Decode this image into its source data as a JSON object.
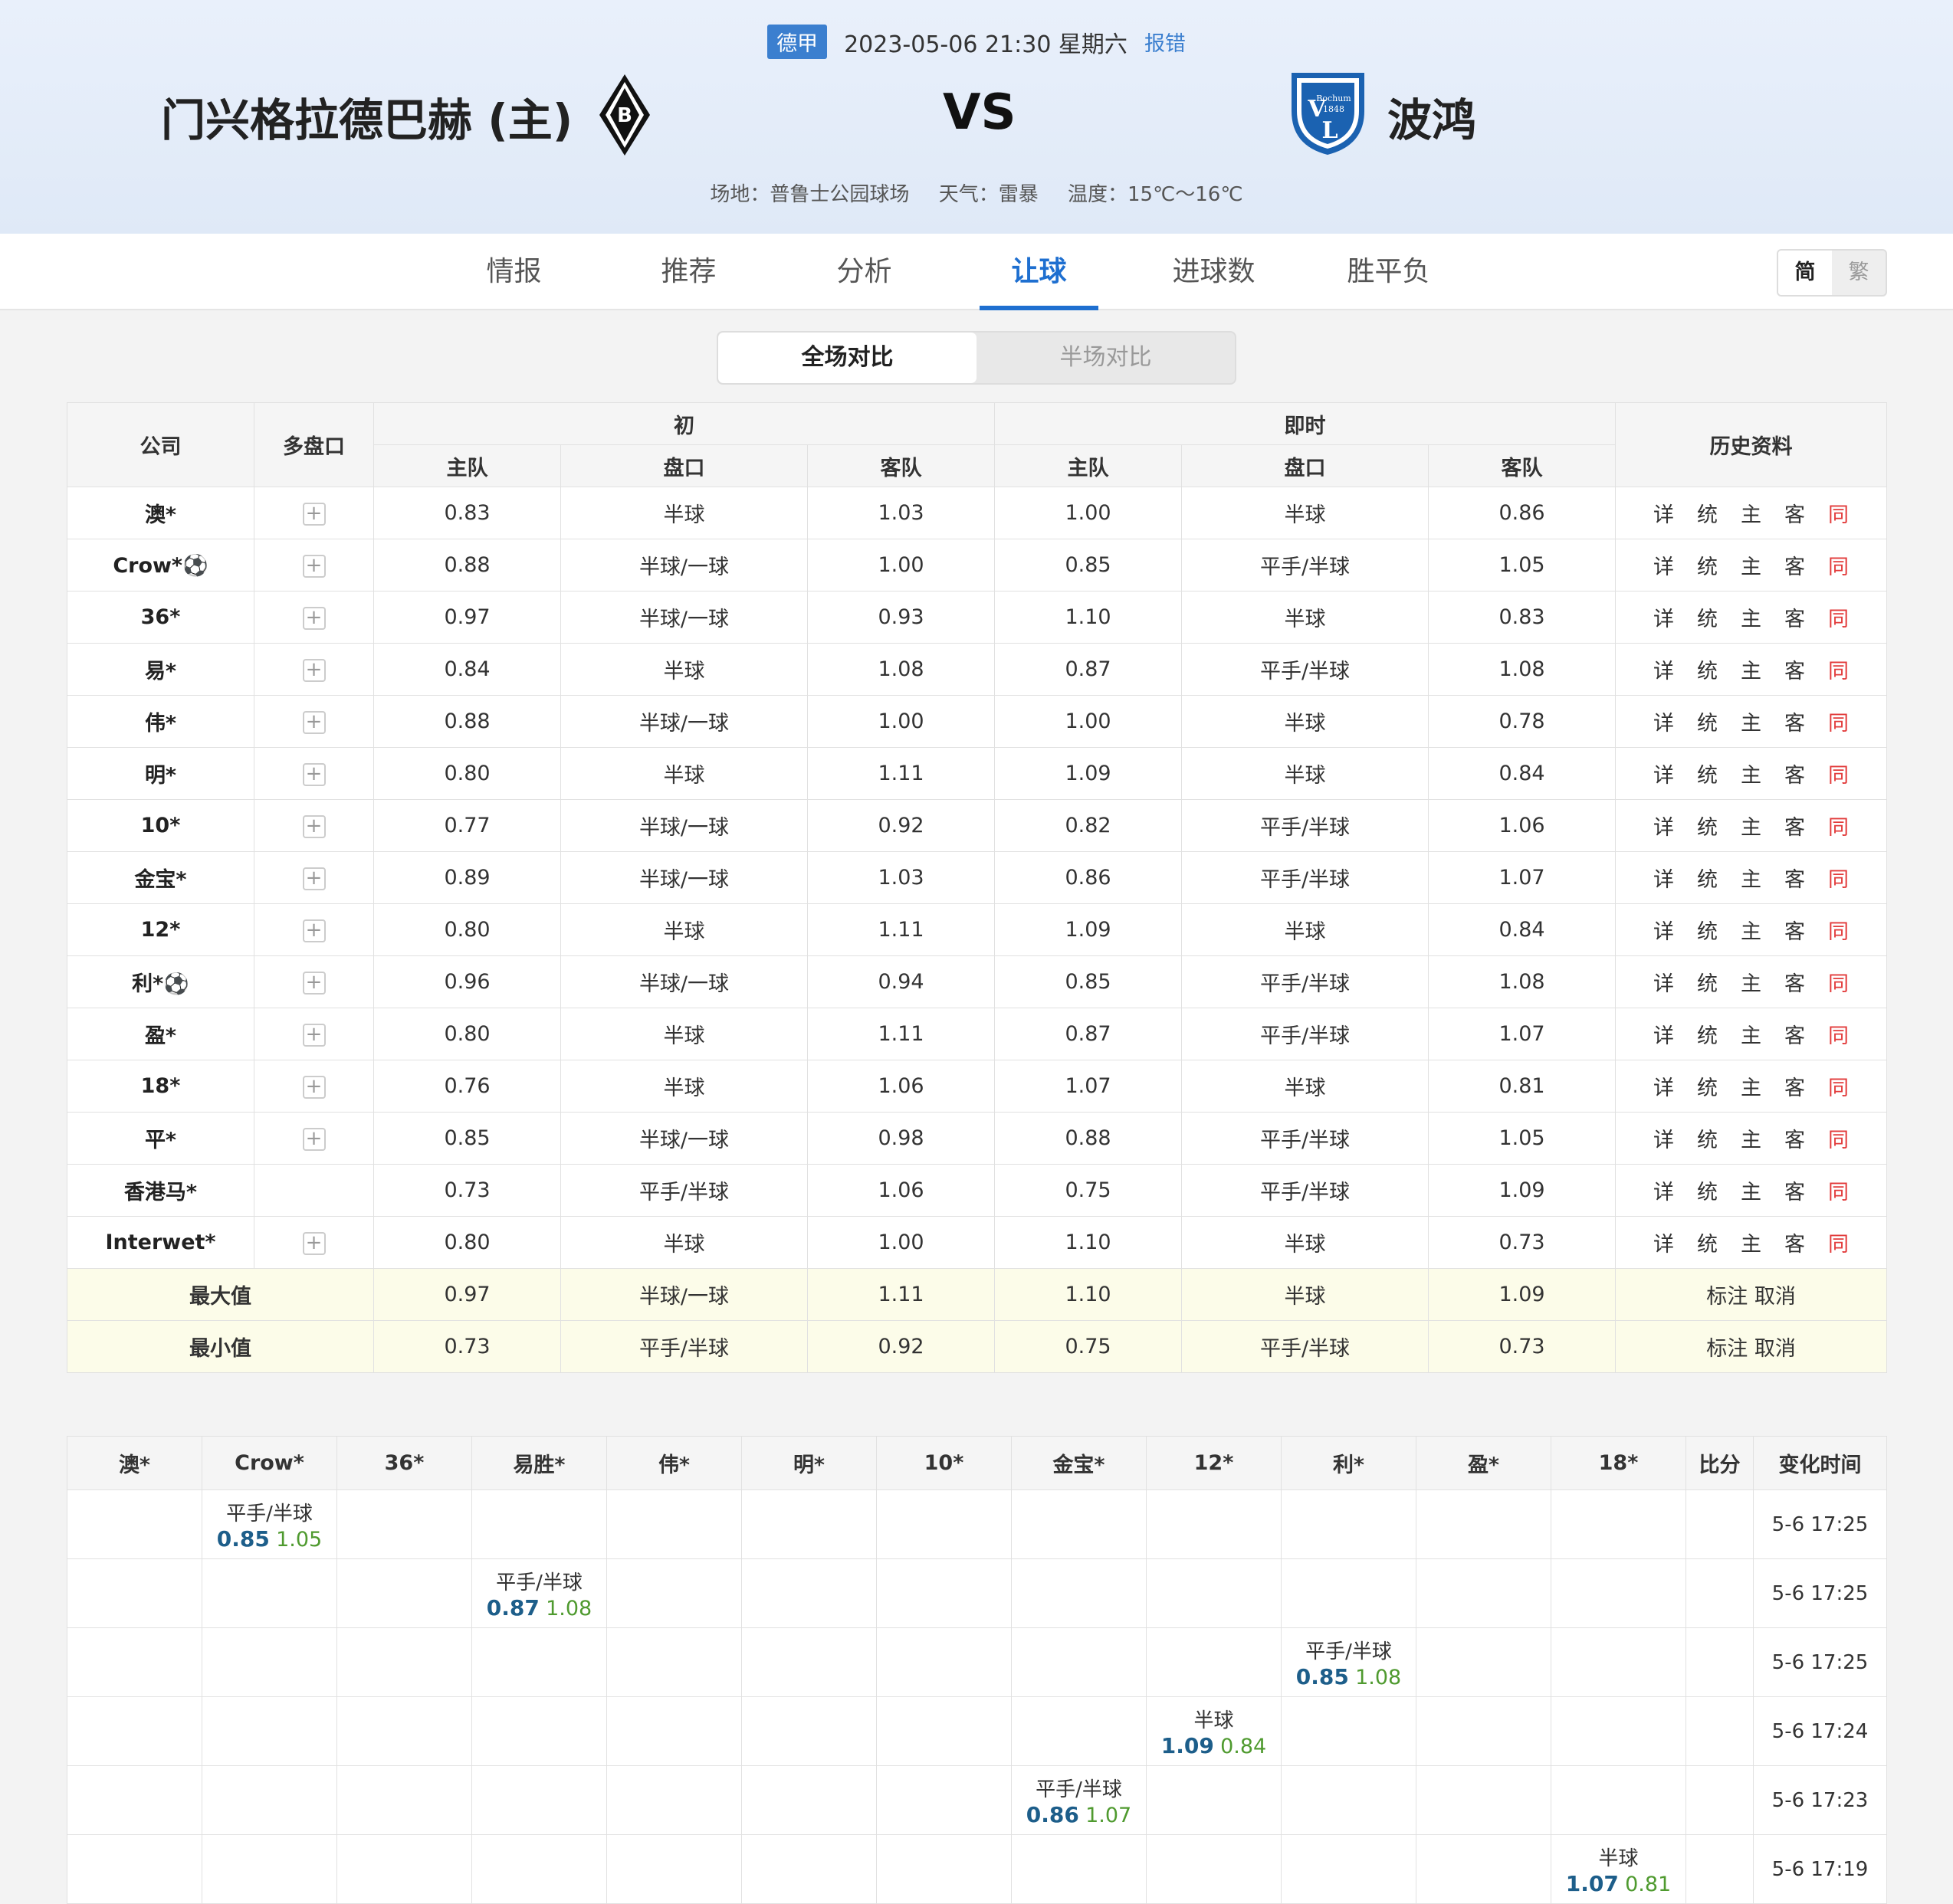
{
  "header": {
    "league": "德甲",
    "datetime": "2023-05-06 21:30 星期六",
    "report": "报错",
    "home": "门兴格拉德巴赫 (主)",
    "vs": "VS",
    "away": "波鸿",
    "venue": "场地：普鲁士公园球场",
    "weather": "天气：雷暴",
    "temperature": "温度：15℃～16℃",
    "away_logo_text": "Bochum 1848"
  },
  "tabs": [
    "情报",
    "推荐",
    "分析",
    "让球",
    "进球数",
    "胜平负"
  ],
  "active_tab": "让球",
  "lang": {
    "simplified": "简",
    "traditional": "繁"
  },
  "segment": {
    "full": "全场对比",
    "half": "半场对比"
  },
  "odds_table": {
    "headers": {
      "company": "公司",
      "multi": "多盘口",
      "initial": "初",
      "live": "即时",
      "history": "历史资料",
      "home": "主队",
      "line": "盘口",
      "away": "客队"
    },
    "history_links": [
      "详",
      "统",
      "主",
      "客",
      "同"
    ],
    "rows": [
      {
        "company": "澳*",
        "plus": true,
        "i_h": "0.83",
        "i_l": "半球",
        "i_a": "1.03",
        "l_h": "1.00",
        "l_l": "半球",
        "l_a": "0.86"
      },
      {
        "company": "Crow*⚽",
        "plus": true,
        "i_h": "0.88",
        "i_l": "半球/一球",
        "i_a": "1.00",
        "l_h": "0.85",
        "l_l": "平手/半球",
        "l_a": "1.05"
      },
      {
        "company": "36*",
        "plus": true,
        "i_h": "0.97",
        "i_l": "半球/一球",
        "i_a": "0.93",
        "l_h": "1.10",
        "l_l": "半球",
        "l_a": "0.83"
      },
      {
        "company": "易*",
        "plus": true,
        "i_h": "0.84",
        "i_l": "半球",
        "i_a": "1.08",
        "l_h": "0.87",
        "l_l": "平手/半球",
        "l_a": "1.08"
      },
      {
        "company": "伟*",
        "plus": true,
        "i_h": "0.88",
        "i_l": "半球/一球",
        "i_a": "1.00",
        "l_h": "1.00",
        "l_l": "半球",
        "l_a": "0.78"
      },
      {
        "company": "明*",
        "plus": true,
        "i_h": "0.80",
        "i_l": "半球",
        "i_a": "1.11",
        "l_h": "1.09",
        "l_l": "半球",
        "l_a": "0.84"
      },
      {
        "company": "10*",
        "plus": true,
        "i_h": "0.77",
        "i_l": "半球/一球",
        "i_a": "0.92",
        "l_h": "0.82",
        "l_l": "平手/半球",
        "l_a": "1.06"
      },
      {
        "company": "金宝*",
        "plus": true,
        "i_h": "0.89",
        "i_l": "半球/一球",
        "i_a": "1.03",
        "l_h": "0.86",
        "l_l": "平手/半球",
        "l_a": "1.07"
      },
      {
        "company": "12*",
        "plus": true,
        "i_h": "0.80",
        "i_l": "半球",
        "i_a": "1.11",
        "l_h": "1.09",
        "l_l": "半球",
        "l_a": "0.84"
      },
      {
        "company": "利*⚽",
        "plus": true,
        "i_h": "0.96",
        "i_l": "半球/一球",
        "i_a": "0.94",
        "l_h": "0.85",
        "l_l": "平手/半球",
        "l_a": "1.08"
      },
      {
        "company": "盈*",
        "plus": true,
        "i_h": "0.80",
        "i_l": "半球",
        "i_a": "1.11",
        "l_h": "0.87",
        "l_l": "平手/半球",
        "l_a": "1.07"
      },
      {
        "company": "18*",
        "plus": true,
        "i_h": "0.76",
        "i_l": "半球",
        "i_a": "1.06",
        "l_h": "1.07",
        "l_l": "半球",
        "l_a": "0.81"
      },
      {
        "company": "平*",
        "plus": true,
        "i_h": "0.85",
        "i_l": "半球/一球",
        "i_a": "0.98",
        "l_h": "0.88",
        "l_l": "平手/半球",
        "l_a": "1.05"
      },
      {
        "company": "香港马*",
        "plus": false,
        "i_h": "0.73",
        "i_l": "平手/半球",
        "i_a": "1.06",
        "l_h": "0.75",
        "l_l": "平手/半球",
        "l_a": "1.09"
      },
      {
        "company": "Interwet*",
        "plus": true,
        "i_h": "0.80",
        "i_l": "半球",
        "i_a": "1.00",
        "l_h": "1.10",
        "l_l": "半球",
        "l_a": "0.73"
      }
    ],
    "summary": [
      {
        "label": "最大值",
        "i_h": "0.97",
        "i_l": "半球/一球",
        "i_a": "1.11",
        "l_h": "1.10",
        "l_l": "半球",
        "l_a": "1.09",
        "action": "标注 取消"
      },
      {
        "label": "最小值",
        "i_h": "0.73",
        "i_l": "平手/半球",
        "i_a": "0.92",
        "l_h": "0.75",
        "l_l": "平手/半球",
        "l_a": "0.73",
        "action": "标注 取消"
      }
    ]
  },
  "changes_table": {
    "headers": [
      "澳*",
      "Crow*",
      "36*",
      "易胜*",
      "伟*",
      "明*",
      "10*",
      "金宝*",
      "12*",
      "利*",
      "盈*",
      "18*",
      "比分",
      "变化时间"
    ],
    "rows": [
      {
        "col": 1,
        "line": "平手/半球",
        "home": "0.85",
        "away": "1.05",
        "time": "5-6 17:25"
      },
      {
        "col": 3,
        "line": "平手/半球",
        "home": "0.87",
        "away": "1.08",
        "time": "5-6 17:25"
      },
      {
        "col": 9,
        "line": "平手/半球",
        "home": "0.85",
        "away": "1.08",
        "time": "5-6 17:25"
      },
      {
        "col": 8,
        "line": "半球",
        "home": "1.09",
        "away": "0.84",
        "time": "5-6 17:24"
      },
      {
        "col": 7,
        "line": "平手/半球",
        "home": "0.86",
        "away": "1.07",
        "time": "5-6 17:23"
      },
      {
        "col": 11,
        "line": "半球",
        "home": "1.07",
        "away": "0.81",
        "time": "5-6 17:19"
      }
    ]
  }
}
